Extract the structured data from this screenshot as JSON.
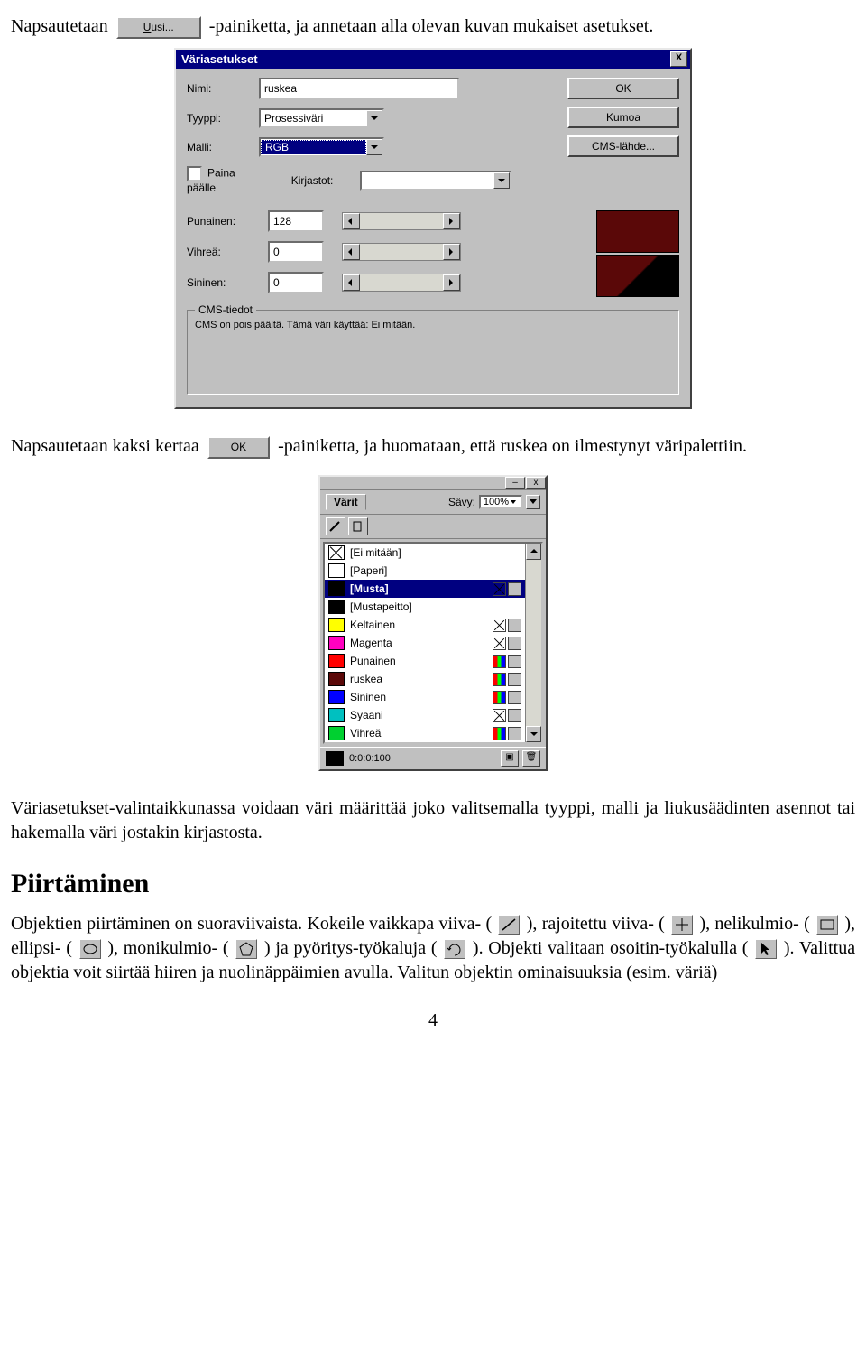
{
  "para1_a": "Napsautetaan ",
  "btn_uusi": "Uusi...",
  "para1_b": "-painiketta, ja annetaan alla olevan kuvan mukaiset asetukset.",
  "dialog": {
    "title": "Väriasetukset",
    "labels": {
      "nimi": "Nimi:",
      "tyyppi": "Tyyppi:",
      "malli": "Malli:",
      "paina": "Paina päälle",
      "kirjastot": "Kirjastot:",
      "punainen": "Punainen:",
      "vihrea": "Vihreä:",
      "sininen": "Sininen:",
      "cms_legend": "CMS-tiedot",
      "cms_text": "CMS on pois päältä. Tämä väri käyttää: Ei mitään."
    },
    "values": {
      "nimi": "ruskea",
      "tyyppi": "Prosessiväri",
      "malli": "RGB",
      "punainen": "128",
      "vihrea": "0",
      "sininen": "0"
    },
    "buttons": {
      "ok": "OK",
      "kumoa": "Kumoa",
      "cms": "CMS-lähde..."
    }
  },
  "para2_a": "Napsautetaan kaksi kertaa ",
  "btn_ok": "OK",
  "para2_b": "-painiketta, ja huomataan, että ruskea on ilmestynyt väripalettiin.",
  "palette": {
    "tab": "Värit",
    "savy_label": "Sävy:",
    "savy_value": "100%",
    "items": [
      "[Ei mitään]",
      "[Paperi]",
      "[Musta]",
      "[Mustapeitto]",
      "Keltainen",
      "Magenta",
      "Punainen",
      "ruskea",
      "Sininen",
      "Syaani",
      "Vihreä"
    ],
    "footer": "0:0:0:100"
  },
  "para3": "Väriasetukset-valintaikkunassa voidaan väri määrittää joko valitsemalla tyyppi, malli ja liukusäädinten asennot tai hakemalla väri jostakin kirjastosta.",
  "heading": "Piirtäminen",
  "para4": {
    "a": "Objektien piirtäminen on suoraviivaista. Kokeile vaikkapa viiva- (",
    "b": "), rajoitettu viiva- (",
    "c": "), nelikulmio- (",
    "d": "), ellipsi- (",
    "e": "), monikulmio- (",
    "f": ") ja pyöritys-työkaluja (",
    "g": "). Objekti valitaan osoitin-työkalulla (",
    "h": "). Valittua objektia voit siirtää hiiren ja nuolinäppäimien avulla. Valitun objektin ominaisuuksia (esim. väriä)"
  },
  "pagenum": "4"
}
